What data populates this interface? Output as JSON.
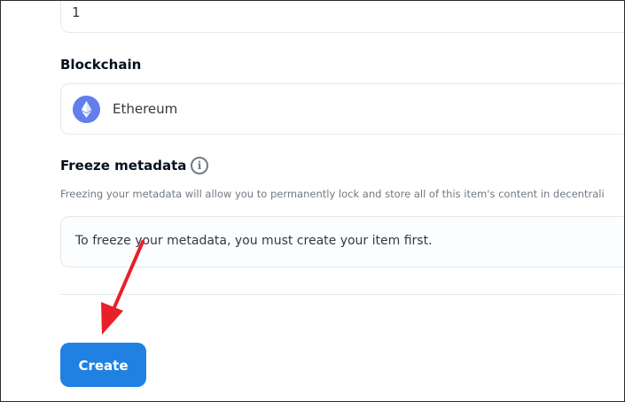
{
  "supply": {
    "value": "1"
  },
  "blockchain": {
    "label": "Blockchain",
    "selected": "Ethereum",
    "icon": "ethereum-icon",
    "icon_color": "#627eea"
  },
  "freeze_metadata": {
    "label": "Freeze metadata",
    "info_icon": "info-icon",
    "description": "Freezing your metadata will allow you to permanently lock and store all of this item's content in decentrali",
    "notice": "To freeze your metadata, you must create your item first."
  },
  "actions": {
    "create_label": "Create",
    "accent": "#2081e2"
  },
  "annotation": {
    "arrow_color": "#e8202a"
  }
}
